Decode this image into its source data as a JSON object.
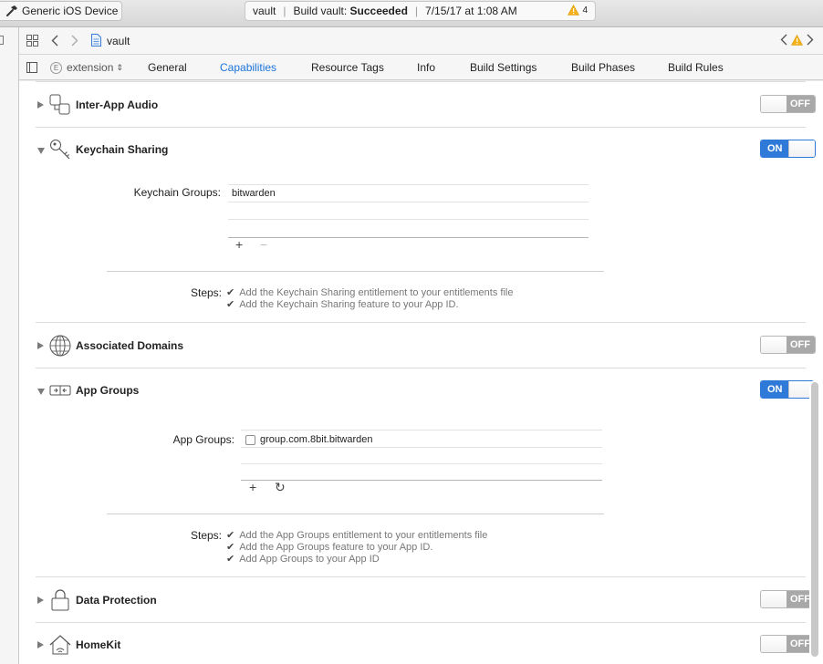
{
  "window": {
    "scheme_device": "Generic iOS Device",
    "activity": {
      "project": "vault",
      "status_prefix": "Build vault: ",
      "status_bold": "Succeeded",
      "timestamp": "7/15/17 at 1:08 AM",
      "warning_count": "4"
    }
  },
  "jumpbar": {
    "file": "vault"
  },
  "tabs": {
    "target": "extension",
    "items": [
      {
        "label": "General"
      },
      {
        "label": "Capabilities"
      },
      {
        "label": "Resource Tags"
      },
      {
        "label": "Info"
      },
      {
        "label": "Build Settings"
      },
      {
        "label": "Build Phases"
      },
      {
        "label": "Build Rules"
      }
    ],
    "active": "Capabilities"
  },
  "capabilities": {
    "inter_app_audio": {
      "title": "Inter-App Audio",
      "toggle": "OFF"
    },
    "keychain_sharing": {
      "title": "Keychain Sharing",
      "toggle": "ON",
      "groups_label": "Keychain Groups:",
      "groups": [
        "bitwarden"
      ],
      "steps_label": "Steps:",
      "steps": [
        "Add the Keychain Sharing entitlement to your entitlements file",
        "Add the Keychain Sharing feature to your App ID."
      ]
    },
    "associated_domains": {
      "title": "Associated Domains",
      "toggle": "OFF"
    },
    "app_groups": {
      "title": "App Groups",
      "toggle": "ON",
      "groups_label": "App Groups:",
      "groups": [
        "group.com.8bit.bitwarden"
      ],
      "steps_label": "Steps:",
      "steps": [
        "Add the App Groups entitlement to your entitlements file",
        "Add the App Groups feature to your App ID.",
        "Add App Groups to your App ID"
      ]
    },
    "data_protection": {
      "title": "Data Protection",
      "toggle": "OFF"
    },
    "homekit": {
      "title": "HomeKit",
      "toggle": "OFF"
    }
  }
}
